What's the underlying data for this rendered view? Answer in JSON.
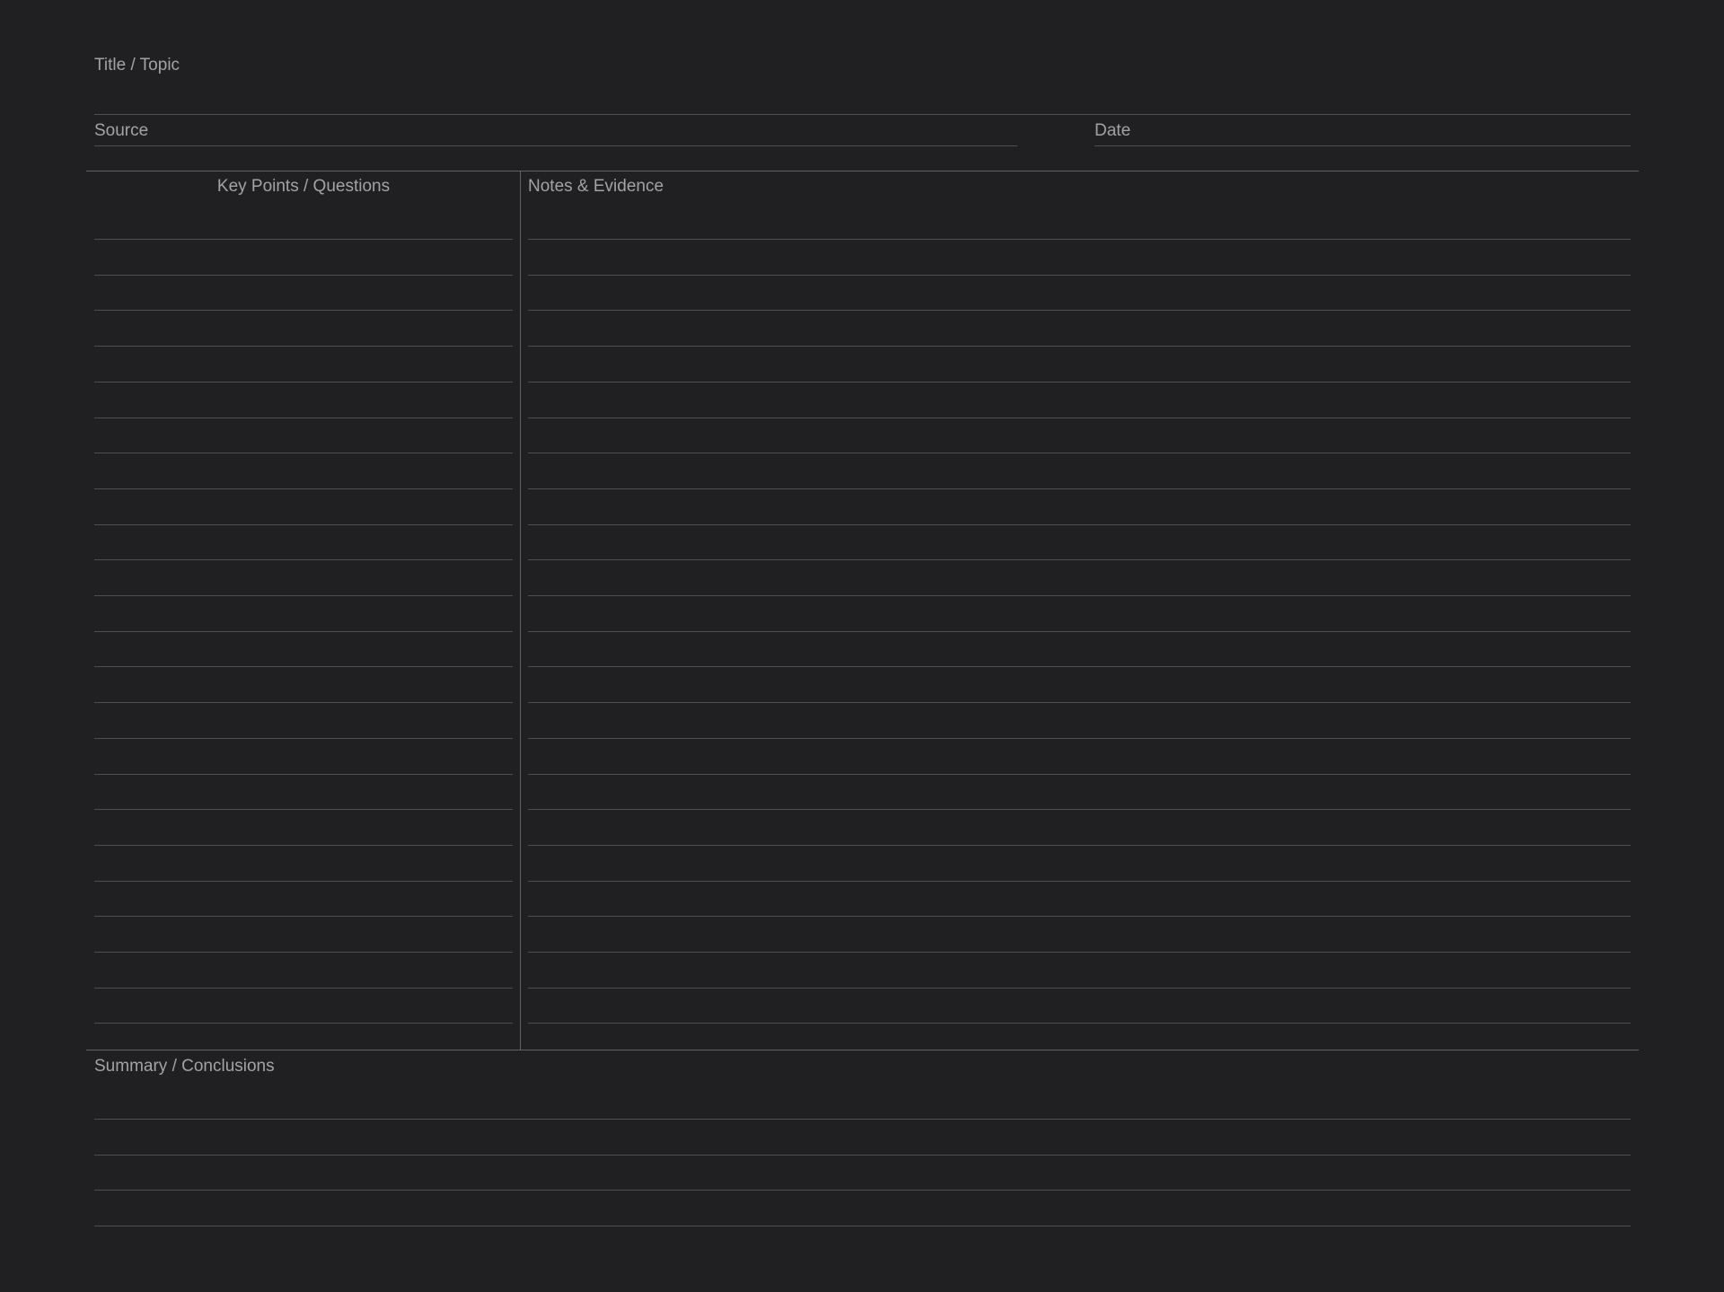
{
  "header": {
    "title_label": "Title / Topic",
    "source_label": "Source",
    "date_label": "Date"
  },
  "columns": {
    "left_label": "Key Points / Questions",
    "right_label": "Notes & Evidence",
    "ruled_line_count": 23
  },
  "summary": {
    "label": "Summary / Conclusions",
    "ruled_line_count": 4
  },
  "colors": {
    "background": "#202022",
    "text": "#a3a3a7",
    "rule": "#4e4e52",
    "frame": "#626266"
  }
}
